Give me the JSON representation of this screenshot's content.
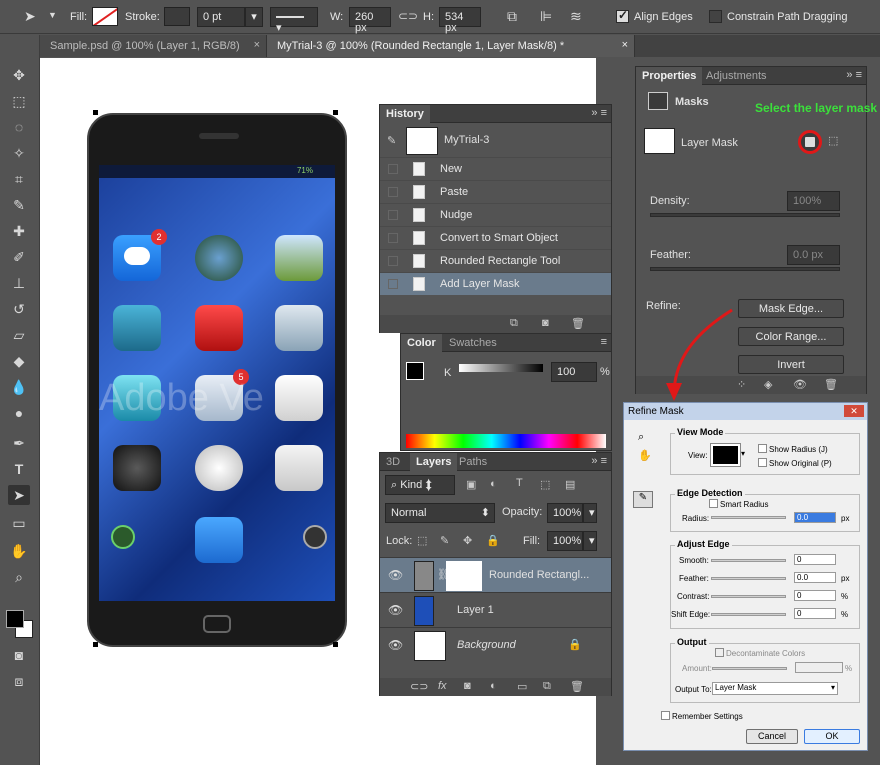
{
  "options_bar": {
    "fill_label": "Fill:",
    "stroke_label": "Stroke:",
    "stroke_width": "0 pt",
    "w_label": "W:",
    "w_value": "260 px",
    "h_label": "H:",
    "h_value": "534 px",
    "align_edges": "Align Edges",
    "constrain": "Constrain Path Dragging"
  },
  "doc_tabs": [
    {
      "label": "Sample.psd @ 100% (Layer 1, RGB/8)",
      "close": "×"
    },
    {
      "label": "MyTrial-3 @ 100% (Rounded Rectangle 1, Layer Mask/8) *",
      "close": "×"
    }
  ],
  "phone": {
    "badge_messages": "2",
    "badge_mail": "5",
    "watermark": "Adobe Ve",
    "status": "71%"
  },
  "history": {
    "title": "History",
    "snapshot": "MyTrial-3",
    "items": [
      "New",
      "Paste",
      "Nudge",
      "Convert to Smart Object",
      "Rounded Rectangle Tool",
      "Add Layer Mask"
    ]
  },
  "color": {
    "tab_color": "Color",
    "tab_swatches": "Swatches",
    "channel": "K",
    "value": "100",
    "unit": "%"
  },
  "layers": {
    "tab_3d": "3D",
    "tab_layers": "Layers",
    "tab_paths": "Paths",
    "kind": "Kind",
    "blend": "Normal",
    "opacity_label": "Opacity:",
    "opacity": "100%",
    "lock_label": "Lock:",
    "fill_label": "Fill:",
    "fill": "100%",
    "items": [
      "Rounded Rectangl...",
      "Layer 1",
      "Background"
    ]
  },
  "properties": {
    "tab_properties": "Properties",
    "tab_adjustments": "Adjustments",
    "section": "Masks",
    "annotation": "Select the layer mask",
    "layer_mask": "Layer Mask",
    "density_label": "Density:",
    "density": "100%",
    "feather_label": "Feather:",
    "feather": "0.0 px",
    "refine_label": "Refine:",
    "mask_edge": "Mask Edge...",
    "color_range": "Color Range...",
    "invert": "Invert"
  },
  "refine": {
    "title": "Refine Mask",
    "view_mode": "View Mode",
    "view_label": "View:",
    "show_radius": "Show Radius (J)",
    "show_original": "Show Original (P)",
    "edge_detection": "Edge Detection",
    "smart_radius": "Smart Radius",
    "radius_label": "Radius:",
    "radius": "0.0",
    "px": "px",
    "adjust_edge": "Adjust Edge",
    "smooth_label": "Smooth:",
    "smooth": "0",
    "feather_label": "Feather:",
    "feather": "0.0",
    "contrast_label": "Contrast:",
    "contrast": "0",
    "shift_label": "Shift Edge:",
    "shift": "0",
    "pct": "%",
    "output": "Output",
    "decontaminate": "Decontaminate Colors",
    "amount_label": "Amount:",
    "output_to_label": "Output To:",
    "output_to": "Layer Mask",
    "remember": "Remember Settings",
    "cancel": "Cancel",
    "ok": "OK"
  }
}
